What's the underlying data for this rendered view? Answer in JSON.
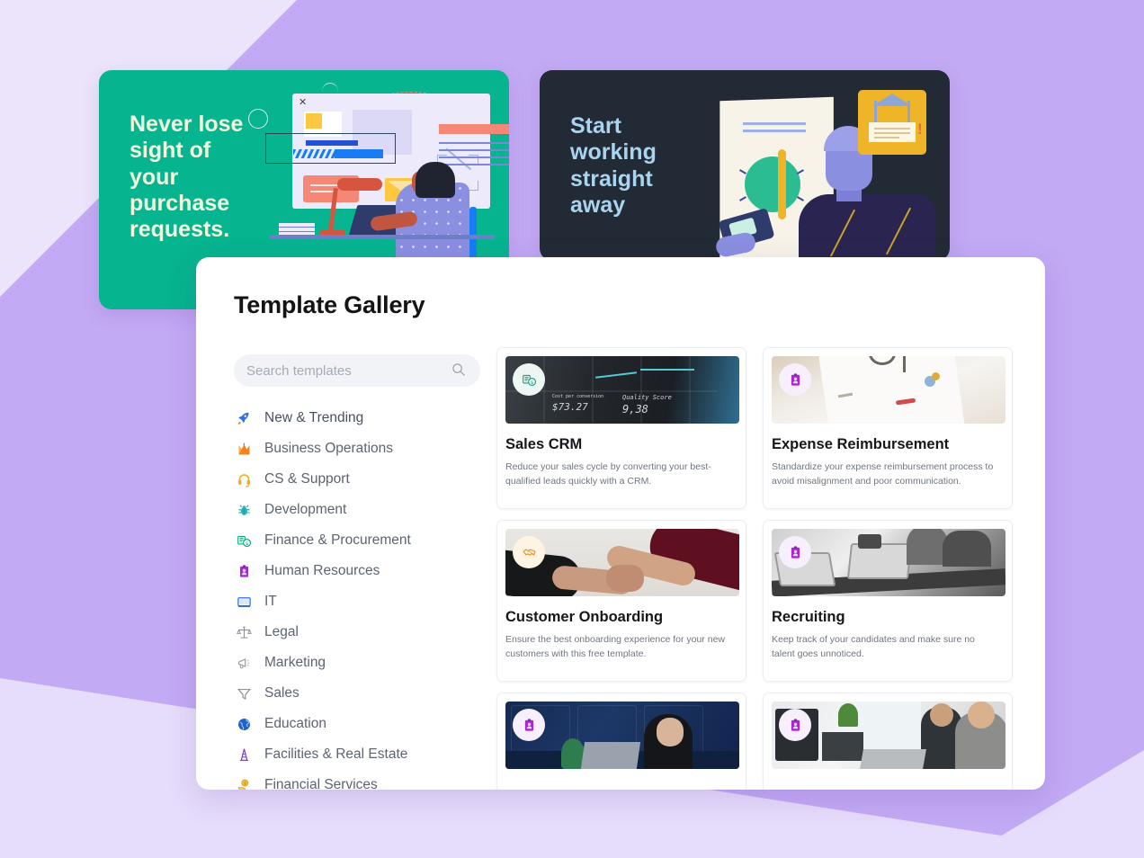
{
  "background": {
    "base_color": "#c3aaf4",
    "accent_color": "#e6dcfb"
  },
  "banners": [
    {
      "id": "purchase-requests",
      "title": "Never lose\nsight of\nyour\npurchase\nrequests.",
      "bg_color": "#06b48f",
      "text_color": "#f2f7dc"
    },
    {
      "id": "start-working",
      "title": "Start\nworking\nstraight\naway",
      "bg_color": "#222b35",
      "text_color": "#a9d3ee"
    }
  ],
  "panel": {
    "title": "Template Gallery",
    "search": {
      "placeholder": "Search templates",
      "value": "",
      "icon": "search-icon"
    },
    "categories": [
      {
        "label": "New & Trending",
        "icon": "rocket-icon",
        "glyph": "🚀",
        "color": "#2f6fe0"
      },
      {
        "label": "Business Operations",
        "icon": "chart-m-icon",
        "glyph": "Μ",
        "color": "#f07c22"
      },
      {
        "label": "CS & Support",
        "icon": "headset-icon",
        "glyph": "◔",
        "color": "#f0ae25"
      },
      {
        "label": "Development",
        "icon": "bug-icon",
        "glyph": "✶",
        "color": "#2bb5b8"
      },
      {
        "label": "Finance & Procurement",
        "icon": "money-icon",
        "glyph": "$",
        "color": "#12a37d"
      },
      {
        "label": "Human Resources",
        "icon": "id-badge-icon",
        "glyph": "▮",
        "color": "#a726d6"
      },
      {
        "label": "IT",
        "icon": "monitor-icon",
        "glyph": "▭",
        "color": "#2f6fe0"
      },
      {
        "label": "Legal",
        "icon": "scales-icon",
        "glyph": "⚖",
        "color": "#8a9099"
      },
      {
        "label": "Marketing",
        "icon": "megaphone-icon",
        "glyph": "◀",
        "color": "#9aa0a8"
      },
      {
        "label": "Sales",
        "icon": "funnel-icon",
        "glyph": "▽",
        "color": "#8a9099"
      },
      {
        "label": "Education",
        "icon": "globe-icon",
        "glyph": "●",
        "color": "#1f63c9"
      },
      {
        "label": "Facilities & Real Estate",
        "icon": "tower-icon",
        "glyph": "A",
        "color": "#7b3fd4"
      },
      {
        "label": "Financial Services",
        "icon": "coin-hand-icon",
        "glyph": "●",
        "color": "#e8a61f"
      }
    ],
    "cards": [
      {
        "title": "Sales CRM",
        "description": "Reduce your sales cycle by converting your best-qualified leads quickly with a CRM.",
        "badge_icon": "money-icon",
        "badge_glyph": "$",
        "badge_bg": "#eef6f3",
        "badge_color": "#12a37d",
        "photo": "crm-dashboard-photo"
      },
      {
        "title": "Expense Reimbursement",
        "description": "Standardize your expense reimbursement process to avoid misalignment and poor communication.",
        "badge_icon": "id-badge-icon",
        "badge_glyph": "▮",
        "badge_bg": "#f7effc",
        "badge_color": "#a726d6",
        "photo": "notebook-desk-photo"
      },
      {
        "title": "Customer Onboarding",
        "description": "Ensure the best onboarding experience for your new customers with this free template.",
        "badge_icon": "handshake-icon",
        "badge_glyph": "◇",
        "badge_bg": "#fdf4e3",
        "badge_color": "#e0922a",
        "photo": "handshake-photo"
      },
      {
        "title": "Recruiting",
        "description": "Keep track of your candidates and make sure no talent goes unnoticed.",
        "badge_icon": "id-badge-icon",
        "badge_glyph": "▮",
        "badge_bg": "#f7effc",
        "badge_color": "#a726d6",
        "photo": "laptops-meeting-photo"
      },
      {
        "title": "",
        "description": "",
        "badge_icon": "id-badge-icon",
        "badge_glyph": "▮",
        "badge_bg": "#f7effc",
        "badge_color": "#a726d6",
        "photo": "man-blue-wall-photo"
      },
      {
        "title": "",
        "description": "",
        "badge_icon": "id-badge-icon",
        "badge_glyph": "▮",
        "badge_bg": "#f7effc",
        "badge_color": "#a726d6",
        "photo": "office-pair-photo"
      }
    ]
  }
}
